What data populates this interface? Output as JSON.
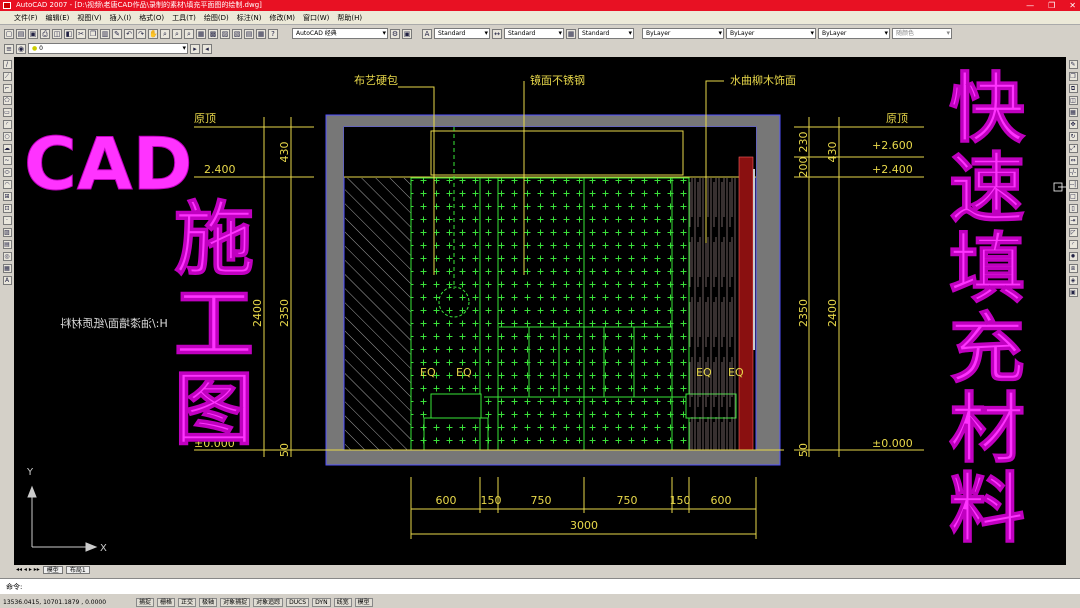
{
  "titlebar": {
    "title": "AutoCAD 2007 - [D:\\视频\\老唐CAD作品\\录制的素材\\填充平面图的绘制.dwg]",
    "min": "—",
    "max": "❐",
    "close": "✕"
  },
  "menu": [
    "文件(F)",
    "编辑(E)",
    "视图(V)",
    "插入(I)",
    "格式(O)",
    "工具(T)",
    "绘图(D)",
    "标注(N)",
    "修改(M)",
    "窗口(W)",
    "帮助(H)"
  ],
  "toolbar": {
    "workspace": "AutoCAD 经典",
    "text_style": "Standard",
    "dim_style": "Standard",
    "table_style": "Standard",
    "color": "ByLayer",
    "linetype": "ByLayer",
    "lineweight": "ByLayer",
    "plot_style": "随颜色",
    "layer": "0"
  },
  "drawing": {
    "callouts": [
      "布艺硬包",
      "镜面不锈钢",
      "水曲柳木饰面"
    ],
    "level_origin_left": "原顶",
    "level_origin_right": "原顶",
    "level_24_left": "2.400",
    "level_26_right": "+2.600",
    "level_24_right": "+2.400",
    "level_0_left": "±0.000",
    "level_0_right": "±0.000",
    "dims_left": [
      "430",
      "2350",
      "2400",
      "50"
    ],
    "dims_right": [
      "230",
      "200",
      "430",
      "2350",
      "2400",
      "50"
    ],
    "dims_bottom": [
      "600",
      "150",
      "750",
      "750",
      "150",
      "600"
    ],
    "dim_total": "3000",
    "eq": [
      "EQ",
      "EQ",
      "EQ",
      "EQ"
    ],
    "mirror_text": "H:/油漆墙面/纸质材料",
    "ucs_x": "X",
    "ucs_y": "Y"
  },
  "overlay": {
    "cad": "CAD",
    "vertical_left": [
      "施",
      "工",
      "图"
    ],
    "vertical_right": [
      "快",
      "速",
      "填",
      "充",
      "材",
      "料"
    ]
  },
  "tabs": [
    "模型",
    "布局1"
  ],
  "command": {
    "label": "命令:"
  },
  "status": {
    "coords": "13536.0415, 10701.1879 , 0.0000",
    "toggles": [
      "捕捉",
      "栅格",
      "正交",
      "极轴",
      "对象捕捉",
      "对象追踪",
      "DUCS",
      "DYN",
      "线宽",
      "模型"
    ]
  },
  "colors": {
    "title_bg": "#e81123",
    "cad_bg": "#000000",
    "annotation": "#ffc040",
    "dim": "#e8d84a",
    "hatch": "#39e639",
    "magenta": "#ff33ff",
    "wall": "#777777"
  }
}
